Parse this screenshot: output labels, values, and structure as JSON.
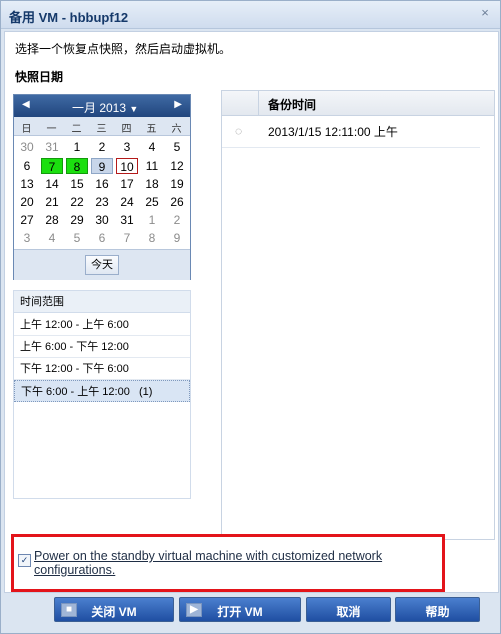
{
  "window": {
    "title": "备用 VM - hbbupf12"
  },
  "instruction": "选择一个恢复点快照，然后启动虚拟机。",
  "snapshot_date_label": "快照日期",
  "calendar": {
    "month_label": "一月 2013",
    "prev_symbol": "◀",
    "next_symbol": "▶",
    "dropdown_symbol": "▼",
    "weekdays": [
      "日",
      "一",
      "二",
      "三",
      "四",
      "五",
      "六"
    ],
    "weeks": [
      [
        "30",
        "31",
        "1",
        "2",
        "3",
        "4",
        "5"
      ],
      [
        "6",
        "7",
        "8",
        "9",
        "10",
        "11",
        "12"
      ],
      [
        "13",
        "14",
        "15",
        "16",
        "17",
        "18",
        "19"
      ],
      [
        "20",
        "21",
        "22",
        "23",
        "24",
        "25",
        "26"
      ],
      [
        "27",
        "28",
        "29",
        "30",
        "31",
        "1",
        "2"
      ],
      [
        "3",
        "4",
        "5",
        "6",
        "7",
        "8",
        "9"
      ]
    ],
    "today_button": "今天"
  },
  "time_range": {
    "header": "时间范围",
    "items": [
      "上午 12:00 - 上午 6:00",
      "上午 6:00 - 下午 12:00",
      "下午 12:00 - 下午 6:00",
      "下午 6:00 - 上午 12:00   (1)"
    ]
  },
  "backup_table": {
    "header": "备份时间",
    "rows": [
      "2013/1/15 12:11:00 上午"
    ]
  },
  "power_on_checkbox": {
    "label": "Power on the standby virtual machine with customized network configurations.",
    "checked": true
  },
  "buttons": {
    "shutdown_vm": "关闭 VM",
    "open_vm": "打开 VM",
    "cancel": "取消",
    "help": "帮助"
  }
}
